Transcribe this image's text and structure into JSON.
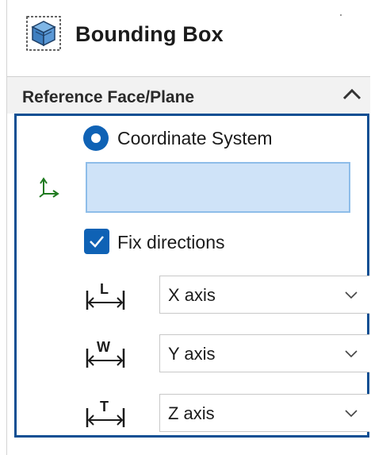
{
  "header": {
    "title": "Bounding Box",
    "icon": "bounding-box-icon"
  },
  "group": {
    "title": "Reference Face/Plane",
    "collapse_icon": "chevron-up-icon",
    "radio_label": "Coordinate System",
    "radio_selected": true,
    "selection_value": "",
    "fix_directions_label": "Fix directions",
    "fix_directions_checked": true,
    "length_axis": {
      "icon_letter": "L",
      "value": "X axis"
    },
    "width_axis": {
      "icon_letter": "W",
      "value": "Y axis"
    },
    "thickness_axis": {
      "icon_letter": "T",
      "value": "Z axis"
    }
  },
  "colors": {
    "accent": "#0f62b5",
    "group_border": "#0d4f93",
    "selection_fill": "#cfe3f8"
  }
}
